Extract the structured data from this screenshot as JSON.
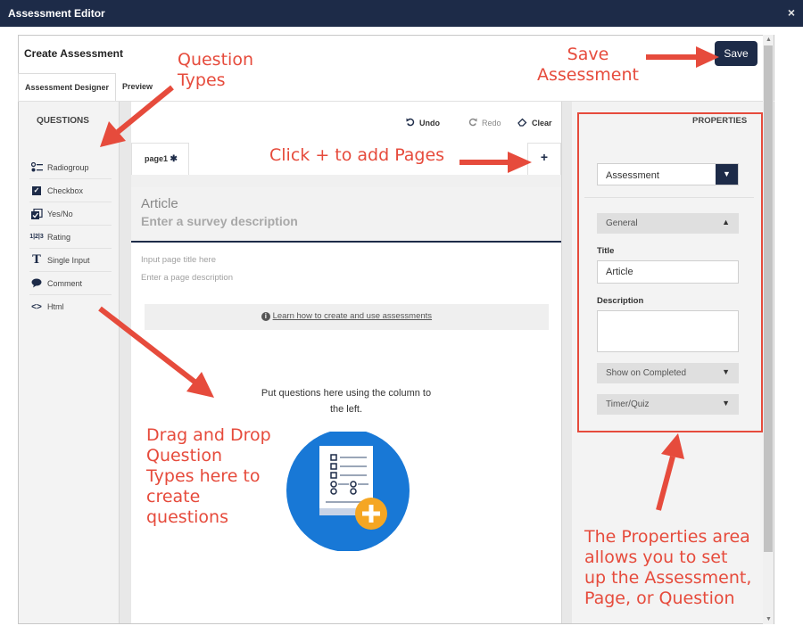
{
  "window": {
    "title": "Assessment Editor",
    "close_glyph": "×"
  },
  "header": {
    "title": "Create Assessment",
    "save_label": "Save"
  },
  "tabs": [
    {
      "label": "Assessment Designer",
      "active": true
    },
    {
      "label": "Preview",
      "active": false
    }
  ],
  "questions_panel": {
    "title": "QUESTIONS",
    "items": [
      {
        "label": "Radiogroup",
        "icon": "radiogroup-icon"
      },
      {
        "label": "Checkbox",
        "icon": "checkbox-icon"
      },
      {
        "label": "Yes/No",
        "icon": "yes-no-icon"
      },
      {
        "label": "Rating",
        "icon": "rating-icon"
      },
      {
        "label": "Single Input",
        "icon": "text-input-icon"
      },
      {
        "label": "Comment",
        "icon": "comment-icon"
      },
      {
        "label": "Html",
        "icon": "code-icon"
      }
    ]
  },
  "toolbar": {
    "undo": "Undo",
    "redo": "Redo",
    "clear": "Clear"
  },
  "pages": {
    "current": "page1",
    "add_label": "+"
  },
  "survey": {
    "title": "Article",
    "description_placeholder": "Enter a survey description",
    "page_title_placeholder": "Input page title here",
    "page_description_placeholder": "Enter a page description",
    "learn_link": "Learn how to create and use assessments",
    "drop_hint": "Put questions here using the column to the left."
  },
  "properties": {
    "title": "PROPERTIES",
    "selected_object": "Assessment",
    "sections": {
      "general": "General",
      "show_on_completed": "Show on Completed",
      "timer_quiz": "Timer/Quiz"
    },
    "title_label": "Title",
    "title_value": "Article",
    "description_label": "Description",
    "description_value": ""
  },
  "annotations": {
    "question_types": "Question\nTypes",
    "save_assessment": "Save\nAssessment",
    "add_pages": "Click + to add Pages",
    "drag_drop": "Drag and Drop\nQuestion\nTypes here to\ncreate\nquestions",
    "properties_area": "The Properties area\nallows you to set\nup the Assessment,\nPage, or Question"
  },
  "colors": {
    "navy": "#1d2b48",
    "annotation_red": "#e64b3c",
    "illustration_blue": "#1878d6",
    "plus_orange": "#f5a623"
  }
}
